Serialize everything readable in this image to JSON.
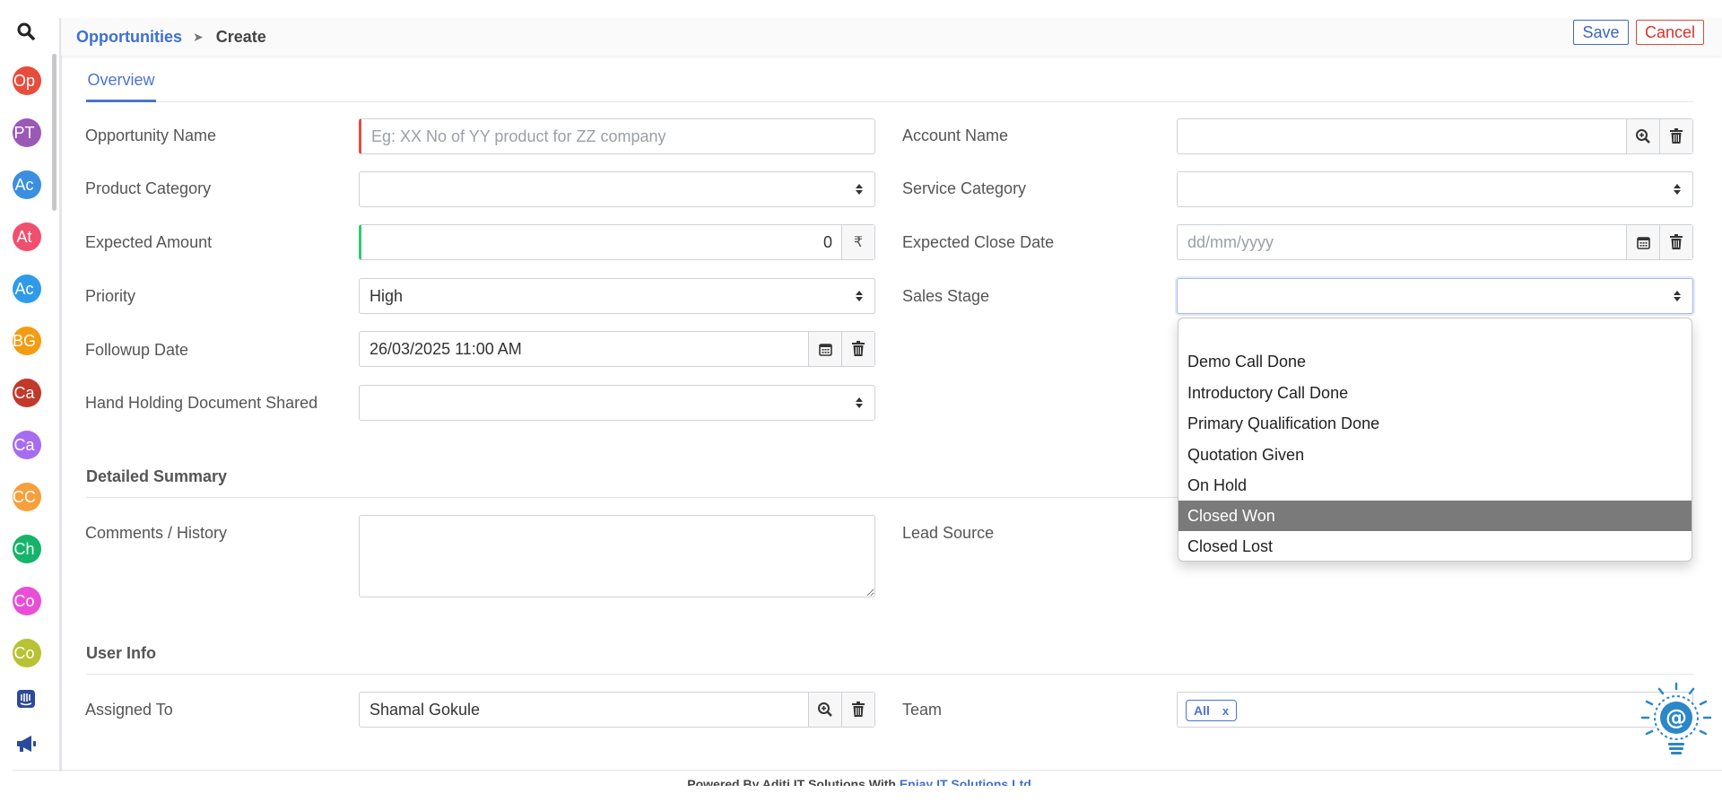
{
  "breadcrumb": {
    "root": "Opportunities",
    "separator": "➤",
    "current": "Create"
  },
  "actions": {
    "save": "Save",
    "cancel": "Cancel"
  },
  "tabs": [
    {
      "label": "Overview",
      "active": true
    }
  ],
  "sidebar": {
    "items": [
      {
        "label": "Op",
        "color": "#e74c3c"
      },
      {
        "label": "PT",
        "color": "#9b59b6"
      },
      {
        "label": "Ac",
        "color": "#3b8ee0"
      },
      {
        "label": "At",
        "color": "#f0506e"
      },
      {
        "label": "Ac",
        "color": "#2f9be8"
      },
      {
        "label": "BG",
        "color": "#f39c12"
      },
      {
        "label": "Ca",
        "color": "#c0392b"
      },
      {
        "label": "Ca",
        "color": "#a66cf0"
      },
      {
        "label": "CC",
        "color": "#f5a03c"
      },
      {
        "label": "Ch",
        "color": "#16b36b"
      },
      {
        "label": "Co",
        "color": "#e84fd6"
      },
      {
        "label": "Co",
        "color": "#b8c233"
      }
    ]
  },
  "form": {
    "opportunity_name": {
      "label": "Opportunity Name",
      "placeholder": "Eg: XX No of YY product for ZZ company"
    },
    "account_name": {
      "label": "Account Name",
      "value": ""
    },
    "product_category": {
      "label": "Product Category",
      "value": ""
    },
    "service_category": {
      "label": "Service Category",
      "value": ""
    },
    "expected_amount": {
      "label": "Expected Amount",
      "value": "0",
      "currency": "₹"
    },
    "expected_close_date": {
      "label": "Expected Close Date",
      "placeholder": "dd/mm/yyyy"
    },
    "priority": {
      "label": "Priority",
      "value": "High"
    },
    "sales_stage": {
      "label": "Sales Stage",
      "value": ""
    },
    "followup_date": {
      "label": "Followup Date",
      "value": "26/03/2025 11:00 AM"
    },
    "hand_holding": {
      "label": "Hand Holding Document Shared",
      "value": ""
    }
  },
  "sales_stage_options": [
    {
      "label": "",
      "selected": false
    },
    {
      "label": "Demo Call Done",
      "selected": false
    },
    {
      "label": "Introductory Call Done",
      "selected": false
    },
    {
      "label": "Primary Qualification Done",
      "selected": false
    },
    {
      "label": "Quotation Given",
      "selected": false
    },
    {
      "label": "On Hold",
      "selected": false
    },
    {
      "label": "Closed Won",
      "selected": true
    },
    {
      "label": "Closed Lost",
      "selected": false
    }
  ],
  "detailed_summary": {
    "title": "Detailed Summary",
    "comments_label": "Comments / History",
    "lead_source_label": "Lead Source"
  },
  "user_info": {
    "title": "User Info",
    "assigned_to_label": "Assigned To",
    "assigned_to_value": "Shamal Gokule",
    "team_label": "Team",
    "team_chip": "All",
    "team_chip_remove": "x"
  },
  "footer": {
    "text": "Powered By Aditi IT Solutions With",
    "link": "Enjay IT Solutions Ltd."
  },
  "colors": {
    "accent": "#4a73d4",
    "danger": "#d9302b",
    "required": "#e74c3c",
    "valid": "#2ecc71"
  }
}
